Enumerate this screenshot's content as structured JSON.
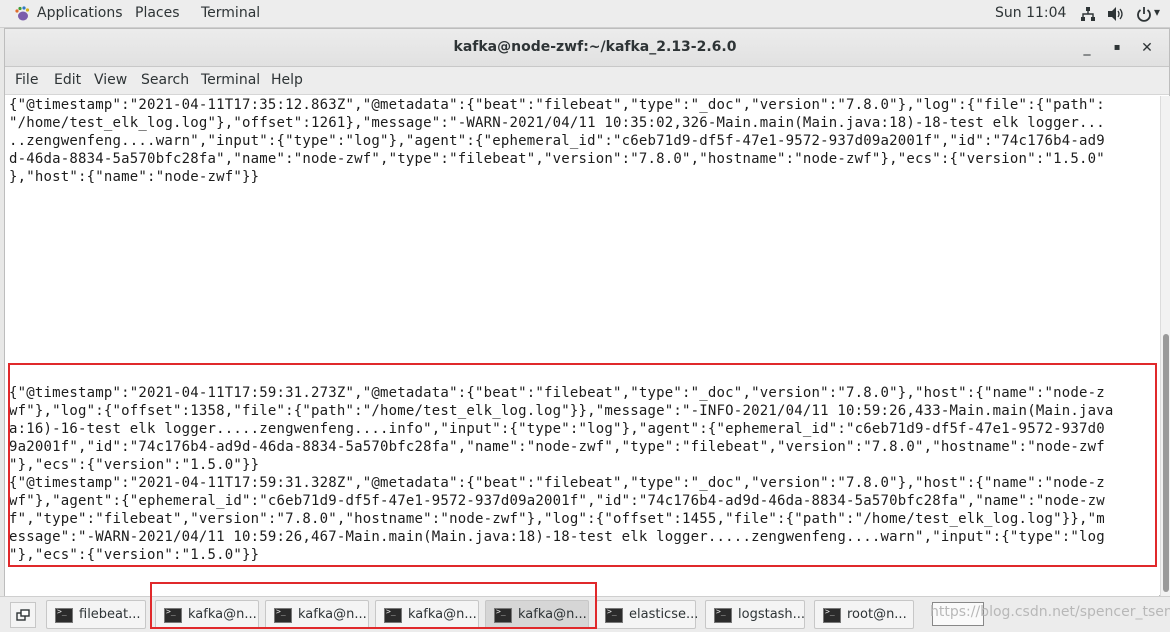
{
  "top_panel": {
    "applications": "Applications",
    "places": "Places",
    "terminal": "Terminal",
    "clock": "Sun 11:04",
    "tray_icons": [
      "network-icon",
      "volume-icon",
      "power-icon"
    ]
  },
  "window": {
    "title": "kafka@node-zwf:~/kafka_2.13-2.6.0",
    "minimize": "_",
    "maximize": "▪",
    "close": "✕"
  },
  "menubar": {
    "items": [
      "File",
      "Edit",
      "View",
      "Search",
      "Terminal",
      "Help"
    ]
  },
  "terminal": {
    "lines": [
      "{\"@timestamp\":\"2021-04-11T17:35:12.863Z\",\"@metadata\":{\"beat\":\"filebeat\",\"type\":\"_doc\",\"version\":\"7.8.0\"},\"log\":{\"file\":{\"path\":",
      "\"/home/test_elk_log.log\"},\"offset\":1261},\"message\":\"-WARN-2021/04/11 10:35:02,326-Main.main(Main.java:18)-18-test elk logger...",
      "..zengwenfeng....warn\",\"input\":{\"type\":\"log\"},\"agent\":{\"ephemeral_id\":\"c6eb71d9-df5f-47e1-9572-937d09a2001f\",\"id\":\"74c176b4-ad9",
      "d-46da-8834-5a570bfc28fa\",\"name\":\"node-zwf\",\"type\":\"filebeat\",\"version\":\"7.8.0\",\"hostname\":\"node-zwf\"},\"ecs\":{\"version\":\"1.5.0\"",
      "},\"host\":{\"name\":\"node-zwf\"}}",
      "{\"@timestamp\":\"2021-04-11T17:59:31.273Z\",\"@metadata\":{\"beat\":\"filebeat\",\"type\":\"_doc\",\"version\":\"7.8.0\"},\"host\":{\"name\":\"node-z",
      "wf\"},\"log\":{\"offset\":1358,\"file\":{\"path\":\"/home/test_elk_log.log\"}},\"message\":\"-INFO-2021/04/11 10:59:26,433-Main.main(Main.java",
      "a:16)-16-test elk logger.....zengwenfeng....info\",\"input\":{\"type\":\"log\"},\"agent\":{\"ephemeral_id\":\"c6eb71d9-df5f-47e1-9572-937d0",
      "9a2001f\",\"id\":\"74c176b4-ad9d-46da-8834-5a570bfc28fa\",\"name\":\"node-zwf\",\"type\":\"filebeat\",\"version\":\"7.8.0\",\"hostname\":\"node-zwf",
      "\"},\"ecs\":{\"version\":\"1.5.0\"}}",
      "{\"@timestamp\":\"2021-04-11T17:59:31.328Z\",\"@metadata\":{\"beat\":\"filebeat\",\"type\":\"_doc\",\"version\":\"7.8.0\"},\"host\":{\"name\":\"node-z",
      "wf\"},\"agent\":{\"ephemeral_id\":\"c6eb71d9-df5f-47e1-9572-937d09a2001f\",\"id\":\"74c176b4-ad9d-46da-8834-5a570bfc28fa\",\"name\":\"node-zw",
      "f\",\"type\":\"filebeat\",\"version\":\"7.8.0\",\"hostname\":\"node-zwf\"},\"log\":{\"offset\":1455,\"file\":{\"path\":\"/home/test_elk_log.log\"}},\"m",
      "essage\":\"-WARN-2021/04/11 10:59:26,467-Main.main(Main.java:18)-18-test elk logger.....zengwenfeng....warn\",\"input\":{\"type\":\"log",
      "\"},\"ecs\":{\"version\":\"1.5.0\"}}"
    ]
  },
  "taskbar": {
    "tasks": [
      {
        "label": "filebeat...",
        "active": false
      },
      {
        "label": "kafka@n...",
        "active": false
      },
      {
        "label": "kafka@n...",
        "active": false
      },
      {
        "label": "kafka@n...",
        "active": false
      },
      {
        "label": "kafka@n...",
        "active": true
      },
      {
        "label": "elasticse...",
        "active": false
      },
      {
        "label": "logstash...",
        "active": false
      },
      {
        "label": "root@n...",
        "active": false
      }
    ],
    "watermark": "https://blog.csdn.net/spencer_tseng"
  },
  "colors": {
    "highlight": "#e0292b",
    "terminal_bg": "#ffffff",
    "terminal_fg": "#1c1c1c"
  }
}
